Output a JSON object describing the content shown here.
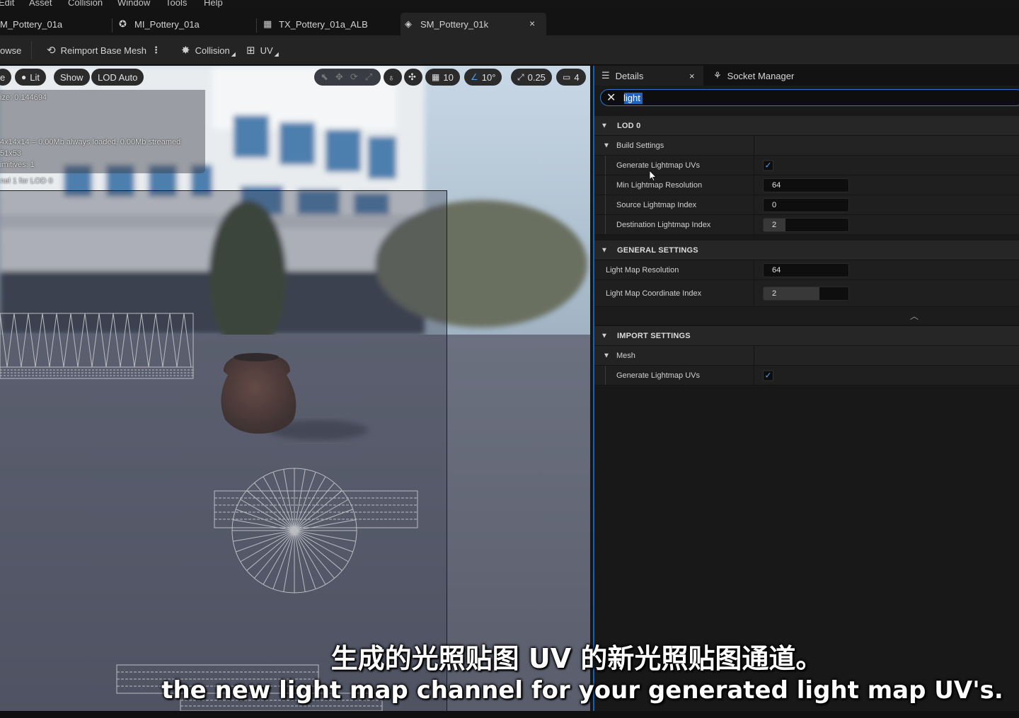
{
  "menubar": {
    "items": [
      "Edit",
      "Asset",
      "Collision",
      "Window",
      "Tools",
      "Help"
    ]
  },
  "tabs": [
    {
      "label": "M_Pottery_01a",
      "icon": "material-icon"
    },
    {
      "label": "MI_Pottery_01a",
      "icon": "material-instance-icon"
    },
    {
      "label": "TX_Pottery_01a_ALB",
      "icon": "texture-icon"
    },
    {
      "label": "SM_Pottery_01k",
      "icon": "static-mesh-icon",
      "active": true,
      "close": "×"
    }
  ],
  "toolbar": {
    "browse_label": "owse",
    "reimport_label": "Reimport Base Mesh",
    "collision_label": "Collision",
    "uv_label": "UV"
  },
  "viewport": {
    "mode_label": "e",
    "lit_label": "Lit",
    "show_label": "Show",
    "lod_label": "LOD Auto",
    "grid_value": "10",
    "angle_value": "10°",
    "scale_value": "0.25",
    "camera_value": "4",
    "stats": {
      "line1": "ize: 0.144694",
      "line2": "4x14x14 = 0.00Mb always loaded, 0.00Mb streamed",
      "line3": "51x53",
      "line4": "imitives: 1",
      "line5": "nel 1 for LOD 0"
    }
  },
  "details": {
    "tab_details": "Details",
    "tab_close": "×",
    "tab_socket": "Socket Manager",
    "search_value": "light",
    "rows": {
      "lod0": "LOD 0",
      "build_settings": "Build Settings",
      "generate_lightmap_uvs": "Generate Lightmap UVs",
      "min_lightmap_resolution": "Min Lightmap Resolution",
      "min_lightmap_resolution_value": "64",
      "source_lightmap_index": "Source Lightmap Index",
      "source_lightmap_index_value": "0",
      "destination_lightmap_index": "Destination Lightmap Index",
      "destination_lightmap_index_value": "2",
      "general_settings": "GENERAL SETTINGS",
      "light_map_resolution": "Light Map Resolution",
      "light_map_resolution_value": "64",
      "light_map_coordinate_index": "Light Map Coordinate Index",
      "light_map_coordinate_index_value": "2",
      "import_settings": "IMPORT SETTINGS",
      "mesh": "Mesh",
      "import_generate_lightmap_uvs": "Generate Lightmap UVs"
    },
    "checked": "✓"
  },
  "subtitles": {
    "chinese": "生成的光照贴图 UV 的新光照贴图通道。",
    "english": "the new light map channel for your generated light map UV's."
  },
  "colors": {
    "accent": "#0b66c2",
    "checkbox": "#4a9df0",
    "panel": "#1f1f1f"
  }
}
